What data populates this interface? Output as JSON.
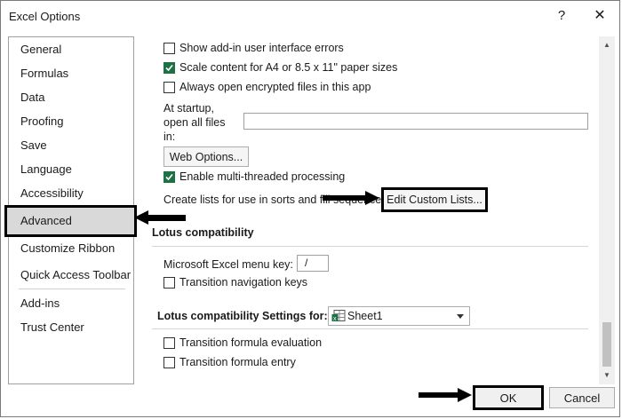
{
  "window": {
    "title": "Excel Options",
    "help_label": "?",
    "close_label": "✕"
  },
  "sidebar": {
    "items": [
      {
        "label": "General"
      },
      {
        "label": "Formulas"
      },
      {
        "label": "Data"
      },
      {
        "label": "Proofing"
      },
      {
        "label": "Save"
      },
      {
        "label": "Language"
      },
      {
        "label": "Accessibility"
      },
      {
        "label": "Advanced",
        "selected": true
      },
      {
        "label": "Customize Ribbon"
      },
      {
        "label": "Quick Access Toolbar"
      },
      {
        "label": "Add-ins"
      },
      {
        "label": "Trust Center"
      }
    ]
  },
  "general_section": {
    "show_addin_errors": {
      "label": "Show add-in user interface errors",
      "checked": false
    },
    "scale_content": {
      "label": "Scale content for A4 or 8.5 x 11\" paper sizes",
      "checked": true
    },
    "always_open_encrypted": {
      "label": "Always open encrypted files in this app",
      "checked": false
    },
    "startup_label_line1": "At startup,",
    "startup_label_line2": "open all files",
    "startup_label_line3": "in:",
    "startup_value": "",
    "web_options_label": "Web Options...",
    "multi_threaded": {
      "label": "Enable multi-threaded processing",
      "checked": true
    },
    "create_lists_text": "Create lists for use in sorts and fill sequences:",
    "edit_custom_lists_label": "Edit Custom Lists..."
  },
  "lotus_compat": {
    "heading": "Lotus compatibility",
    "menu_key_label": "Microsoft Excel menu key:",
    "menu_key_value": "/",
    "transition_nav_keys": {
      "label": "Transition navigation keys",
      "checked": false
    }
  },
  "lotus_settings": {
    "heading": "Lotus compatibility Settings for:",
    "sheet_value": "Sheet1",
    "transition_formula_eval": {
      "label": "Transition formula evaluation",
      "checked": false
    },
    "transition_formula_entry": {
      "label": "Transition formula entry",
      "checked": false
    }
  },
  "footer": {
    "ok_label": "OK",
    "cancel_label": "Cancel"
  },
  "colors": {
    "checkbox_checked": "#1e7145",
    "selected_nav_bg": "#d9d9d9",
    "highlight_border": "#000000"
  },
  "icons": [
    "help-icon",
    "close-icon",
    "check-icon",
    "sheet-icon",
    "chevron-down-icon",
    "scroll-up-icon",
    "scroll-down-icon",
    "arrow-pointer-icon"
  ]
}
